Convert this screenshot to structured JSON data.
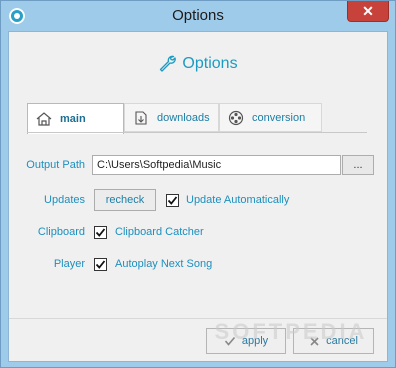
{
  "window": {
    "title": "Options",
    "close_label": "✕"
  },
  "header": {
    "title": "Options"
  },
  "tabs": [
    {
      "label": "main",
      "icon": "home-icon",
      "active": true
    },
    {
      "label": "downloads",
      "icon": "download-icon",
      "active": false
    },
    {
      "label": "conversion",
      "icon": "film-reel-icon",
      "active": false
    }
  ],
  "settings": {
    "output_path_label": "Output Path",
    "output_path_value": "C:\\Users\\Softpedia\\Music",
    "browse_label": "...",
    "updates_label": "Updates",
    "recheck_label": "recheck",
    "update_auto_label": "Update Automatically",
    "update_auto_checked": true,
    "clipboard_label": "Clipboard",
    "clipboard_catcher_label": "Clipboard Catcher",
    "clipboard_catcher_checked": true,
    "player_label": "Player",
    "autoplay_label": "Autoplay Next Song",
    "autoplay_checked": true
  },
  "footer": {
    "apply_label": "apply",
    "cancel_label": "cancel"
  },
  "watermark": "SOFTPEDIA",
  "colors": {
    "accent": "#1c9bc2",
    "close": "#c7423a",
    "frame": "#9fcbea"
  }
}
